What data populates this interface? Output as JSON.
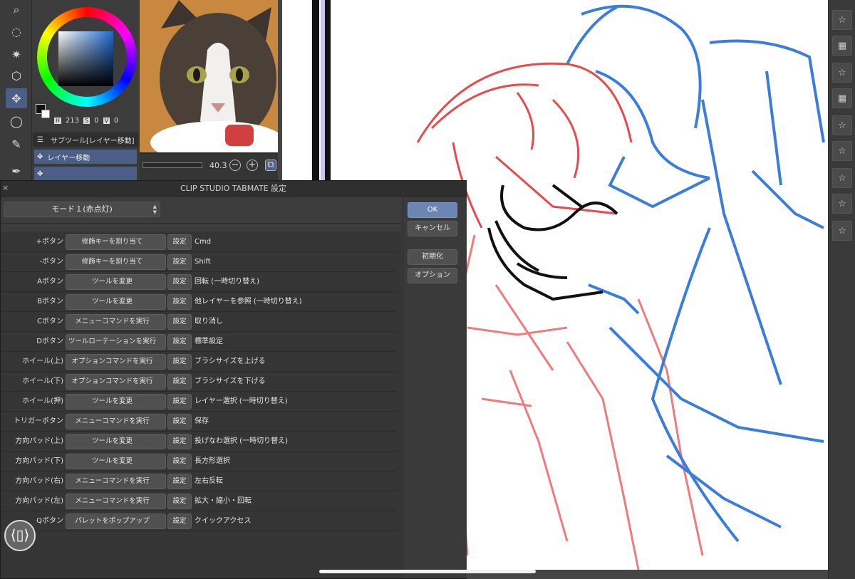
{
  "colors": {
    "accent": "#6c86b4",
    "panel": "#3c3c3c",
    "sketch_blue": "#3a7ddc",
    "sketch_red": "#e8474a"
  },
  "tools": {
    "items": [
      {
        "icon": "zoom-icon",
        "glyph": "⌕"
      },
      {
        "icon": "lasso-select-icon",
        "glyph": "◌"
      },
      {
        "icon": "magic-wand-icon",
        "glyph": "✷"
      },
      {
        "icon": "object-select-icon",
        "glyph": "⬡"
      },
      {
        "icon": "move-layer-icon",
        "glyph": "✥"
      },
      {
        "icon": "lasso-fill-icon",
        "glyph": "◯"
      },
      {
        "icon": "eyedropper-icon",
        "glyph": "✎"
      },
      {
        "icon": "pen-icon",
        "glyph": "✒"
      }
    ]
  },
  "color_panel": {
    "h_label": "H",
    "h": "213",
    "s_label": "S",
    "s": "0",
    "v_label": "V",
    "v": "0"
  },
  "subtool": {
    "header": "サブツール[レイヤー移動]",
    "item1": "レイヤー移動"
  },
  "navigator": {
    "zoom": "40.3",
    "zoom_out": "−",
    "zoom_in": "+"
  },
  "dialog": {
    "title": "CLIP STUDIO TABMATE 設定",
    "close": "×",
    "mode": "モード１(赤点灯)",
    "ok": "OK",
    "cancel": "キャンセル",
    "reset": "初期化",
    "options": "オプション",
    "set_label": "設定",
    "rows": [
      {
        "label": "+ボタン",
        "action": "修飾キーを割り当て",
        "value": "Cmd"
      },
      {
        "label": "-ボタン",
        "action": "修飾キーを割り当て",
        "value": "Shift"
      },
      {
        "label": "Aボタン",
        "action": "ツールを変更",
        "value": "回転 (一時切り替え)"
      },
      {
        "label": "Bボタン",
        "action": "ツールを変更",
        "value": "他レイヤーを参照 (一時切り替え)"
      },
      {
        "label": "Cボタン",
        "action": "メニューコマンドを実行",
        "value": "取り消し"
      },
      {
        "label": "Dボタン",
        "action": "ツールローテーションを実行",
        "value": "標準設定"
      },
      {
        "label": "ホイール(上)",
        "action": "オプションコマンドを実行",
        "value": "ブラシサイズを上げる"
      },
      {
        "label": "ホイール(下)",
        "action": "オプションコマンドを実行",
        "value": "ブラシサイズを下げる"
      },
      {
        "label": "ホイール(押)",
        "action": "ツールを変更",
        "value": "レイヤー選択 (一時切り替え)"
      },
      {
        "label": "トリガーボタン",
        "action": "メニューコマンドを実行",
        "value": "保存"
      },
      {
        "label": "方向パッド(上)",
        "action": "ツールを変更",
        "value": "投げなわ選択 (一時切り替え)"
      },
      {
        "label": "方向パッド(下)",
        "action": "ツールを変更",
        "value": "長方形選択"
      },
      {
        "label": "方向パッド(右)",
        "action": "メニューコマンドを実行",
        "value": "左右反転"
      },
      {
        "label": "方向パッド(左)",
        "action": "メニューコマンドを実行",
        "value": "拡大・縮小・回転"
      },
      {
        "label": "Qボタン",
        "action": "パレットをポップアップ",
        "value": "クイックアクセス"
      }
    ]
  }
}
